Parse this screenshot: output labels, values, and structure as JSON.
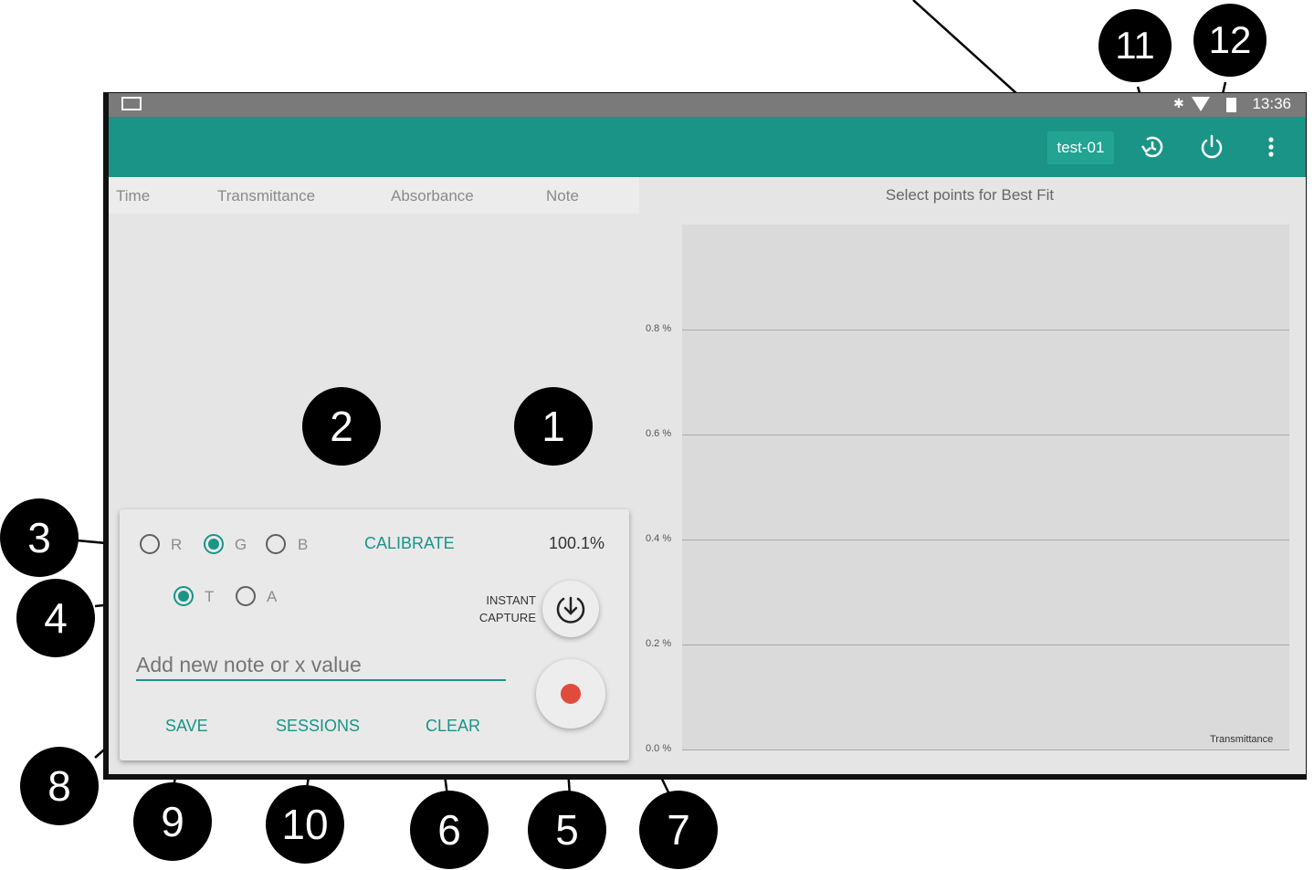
{
  "status_bar": {
    "time": "13:36"
  },
  "app_bar": {
    "session_name": "test-01"
  },
  "table": {
    "headers": [
      "Time",
      "Transmittance",
      "Absorbance",
      "Note"
    ]
  },
  "chart_data": {
    "type": "line",
    "title": "Select points for Best Fit",
    "xlabel": "",
    "ylabel": "",
    "ytick_labels": [
      "0.8 %",
      "0.6 %",
      "0.4 %",
      "0.2 %",
      "0.0 %"
    ],
    "ylim": [
      0.0,
      0.8
    ],
    "legend": "Transmittance",
    "legend_placement": "bottom-right",
    "series": [
      {
        "name": "Transmittance",
        "values": []
      }
    ],
    "grid": true
  },
  "controls": {
    "color_options": [
      "R",
      "G",
      "B"
    ],
    "color_selected": "G",
    "mode_options": [
      "T",
      "A"
    ],
    "mode_selected": "T",
    "calibrate_label": "CALIBRATE",
    "reading": "100.1%",
    "instant_capture_line1": "INSTANT",
    "instant_capture_line2": "CAPTURE",
    "note_placeholder": "Add new note or x value",
    "save_label": "SAVE",
    "sessions_label": "SESSIONS",
    "clear_label": "CLEAR",
    "record_color": "#e04b3c"
  },
  "callouts": [
    "1",
    "2",
    "3",
    "4",
    "5",
    "6",
    "7",
    "8",
    "9",
    "10",
    "11",
    "12"
  ],
  "colors": {
    "primary": "#1a9486",
    "record": "#e04b3c"
  }
}
